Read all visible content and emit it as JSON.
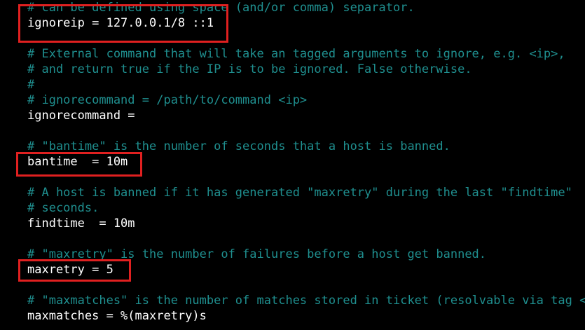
{
  "editor": {
    "colors": {
      "background": "#000000",
      "comment": "#1f8f8f",
      "code": "#ffffff",
      "highlight_box": "#e02020"
    },
    "lines": {
      "l01": "# can be defined using space (and/or comma) separator.",
      "l02": "ignoreip = 127.0.0.1/8 ::1",
      "l03": "# External command that will take an tagged arguments to ignore, e.g. <ip>,",
      "l04": "# and return true if the IP is to be ignored. False otherwise.",
      "l05": "#",
      "l06": "# ignorecommand = /path/to/command <ip>",
      "l07": "ignorecommand =",
      "l08": "# \"bantime\" is the number of seconds that a host is banned.",
      "l09": "bantime  = 10m",
      "l10": "# A host is banned if it has generated \"maxretry\" during the last \"findtime\"",
      "l11": "# seconds.",
      "l12": "findtime  = 10m",
      "l13": "# \"maxretry\" is the number of failures before a host get banned.",
      "l14": "maxretry = 5",
      "l15": "# \"maxmatches\" is the number of matches stored in ticket (resolvable via tag <ma",
      "l16": "maxmatches = %(maxretry)s"
    }
  }
}
